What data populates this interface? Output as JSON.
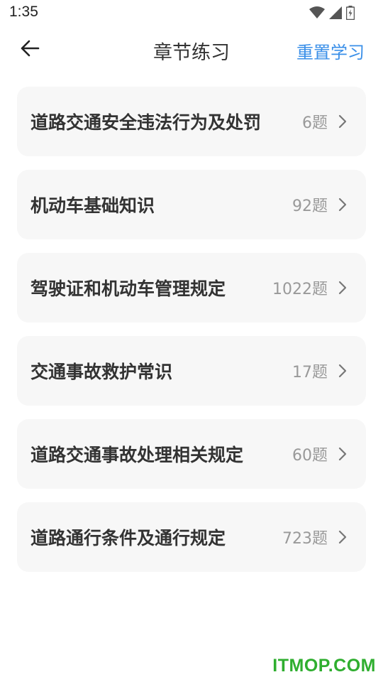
{
  "status_bar": {
    "time": "1:35",
    "icons": [
      "wifi-icon",
      "signal-icon",
      "battery-icon"
    ]
  },
  "nav": {
    "back_icon": "arrow-left-icon",
    "title": "章节练习",
    "reset_label": "重置学习"
  },
  "colors": {
    "accent": "#3a8fe8",
    "card_bg": "#f7f7f7",
    "watermark": "#2fae2f"
  },
  "chapters": [
    {
      "name": "道路交通安全违法行为及处罚",
      "count": "6题"
    },
    {
      "name": "机动车基础知识",
      "count": "92题"
    },
    {
      "name": "驾驶证和机动车管理规定",
      "count": "1022题"
    },
    {
      "name": "交通事故救护常识",
      "count": "17题"
    },
    {
      "name": "道路交通事故处理相关规定",
      "count": "60题"
    },
    {
      "name": "道路通行条件及通行规定",
      "count": "723题"
    }
  ],
  "watermark": "ITMOP.COM"
}
